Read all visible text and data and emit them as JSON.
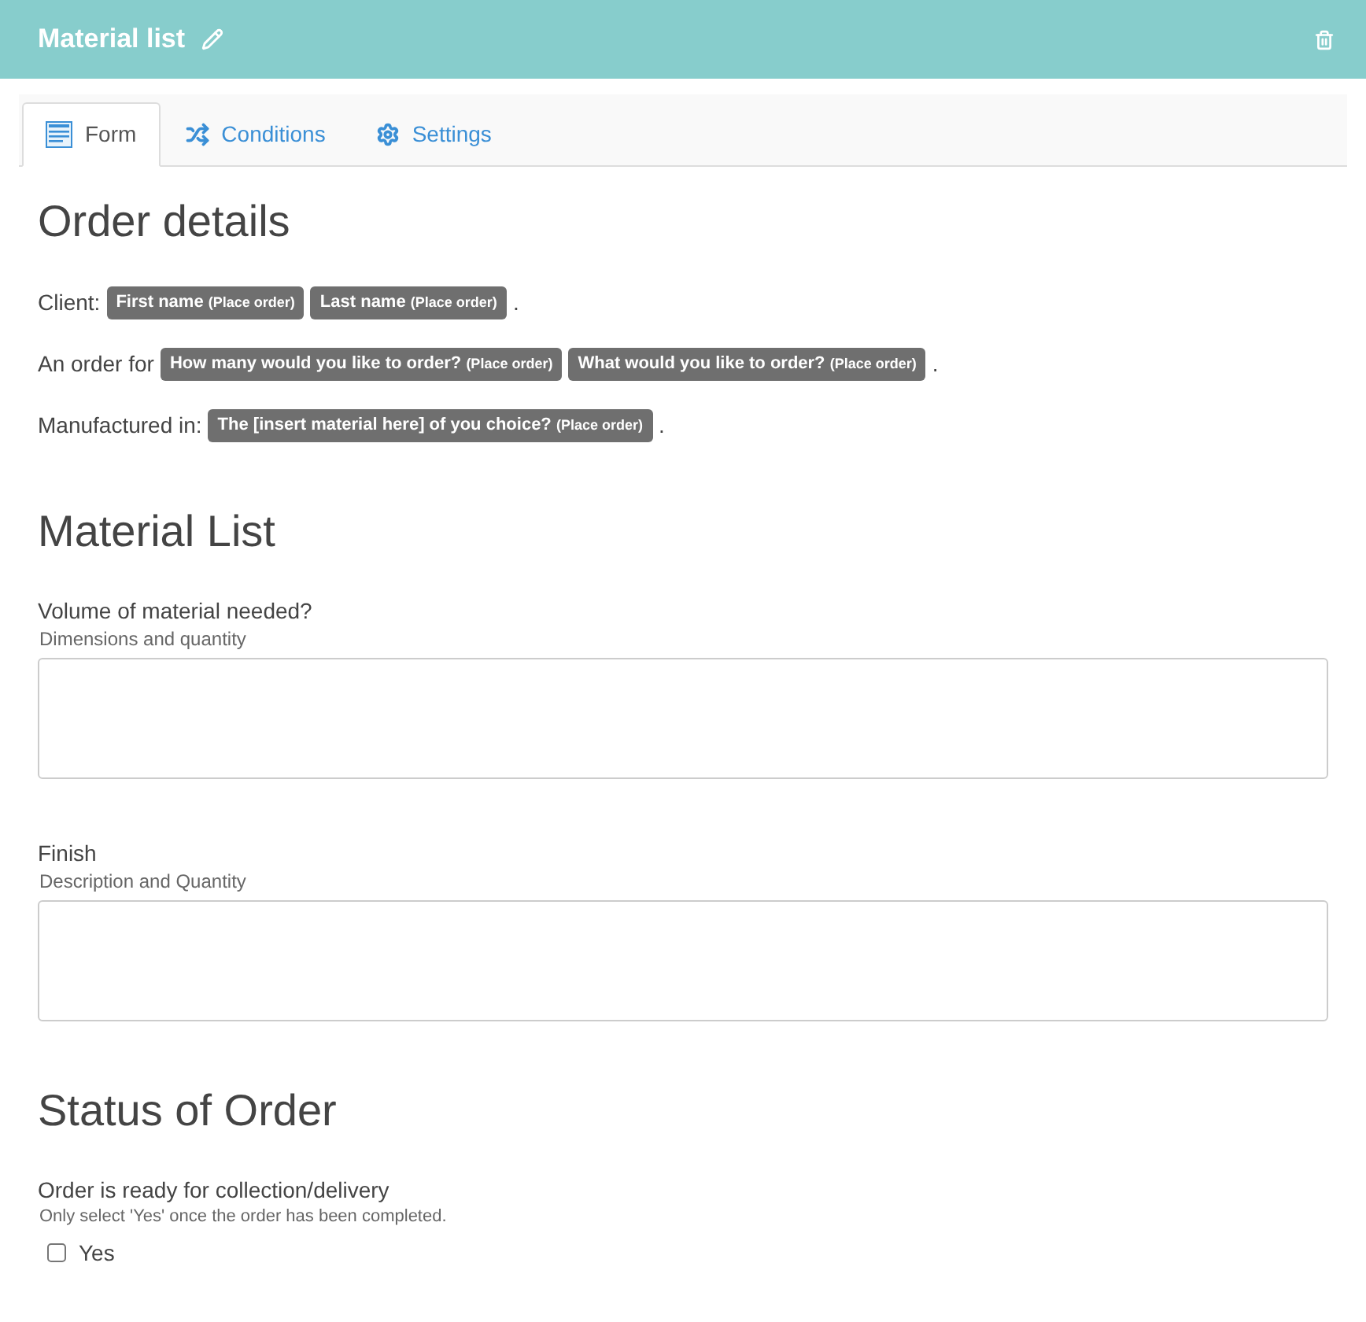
{
  "header": {
    "title": "Material list"
  },
  "tabs": [
    {
      "label": "Form",
      "kind": "form",
      "selected": true
    },
    {
      "label": "Conditions",
      "kind": "conditions",
      "selected": false
    },
    {
      "label": "Settings",
      "kind": "settings",
      "selected": false
    }
  ],
  "sections": [
    {
      "heading": "Order details",
      "items": [
        {
          "kind": "line",
          "label": "Client:",
          "tags": [
            {
              "text": "First name",
              "note": "(Place order)"
            },
            {
              "text": "Last name",
              "note": "(Place order)"
            }
          ],
          "end": "."
        },
        {
          "kind": "line",
          "label": "An order for",
          "tags": [
            {
              "text": "How many would you like to order?",
              "note": "(Place order)"
            },
            {
              "text": "What would you like to order?",
              "note": "(Place order)"
            }
          ],
          "end": "."
        },
        {
          "kind": "line",
          "label": "Manufactured in:",
          "tags": [
            {
              "text": "The [insert material here] of you choice?",
              "note": "(Place order)"
            }
          ],
          "end": "."
        }
      ]
    },
    {
      "heading": "Material List",
      "items": [
        {
          "kind": "textarea",
          "label": "Volume of material needed?",
          "hint": "Dimensions and quantity"
        },
        {
          "kind": "textarea",
          "label": "Finish",
          "hint": "Description and Quantity"
        }
      ]
    },
    {
      "heading": "Status of Order",
      "items": [
        {
          "kind": "checkbox",
          "label": "Order is ready for collection/delivery",
          "hint": "Only select 'Yes' once the order has been completed.",
          "options": [
            {
              "label": "Yes",
              "checked": false
            }
          ]
        }
      ]
    }
  ]
}
